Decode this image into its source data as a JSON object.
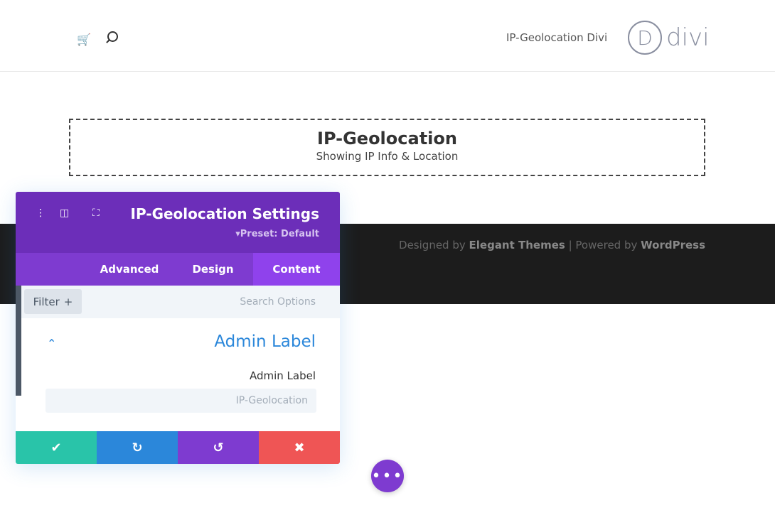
{
  "header": {
    "site_title": "IP-Geolocation Divi",
    "logo_letter": "D",
    "logo_text": "divi",
    "cart_icon": "cart-icon",
    "search_icon": "search-icon"
  },
  "module": {
    "title": "IP-Geolocation",
    "subtitle": "Showing IP Info & Location"
  },
  "footer": {
    "designed_by": "Designed by ",
    "elegant": "Elegant Themes",
    "sep": " | Powered by ",
    "wordpress": "WordPress"
  },
  "panel": {
    "title": "IP-Geolocation Settings",
    "preset": "▾Preset: Default",
    "tabs": [
      {
        "label": "Advanced"
      },
      {
        "label": "Design"
      },
      {
        "label": "Content",
        "active": true
      }
    ],
    "filter_label": "Filter",
    "search_placeholder": "Search Options",
    "group_title": "Admin Label",
    "field_label": "Admin Label",
    "field_value": "IP-Geolocation",
    "colors": {
      "header": "#6c2eb9",
      "tabs": "#7e3bd0",
      "active_tab": "#8f42ec",
      "save": "#29c4a9",
      "redo": "#2b87da",
      "undo": "#7e3bd0",
      "close": "#ef5555"
    }
  },
  "fab_label": "•••"
}
